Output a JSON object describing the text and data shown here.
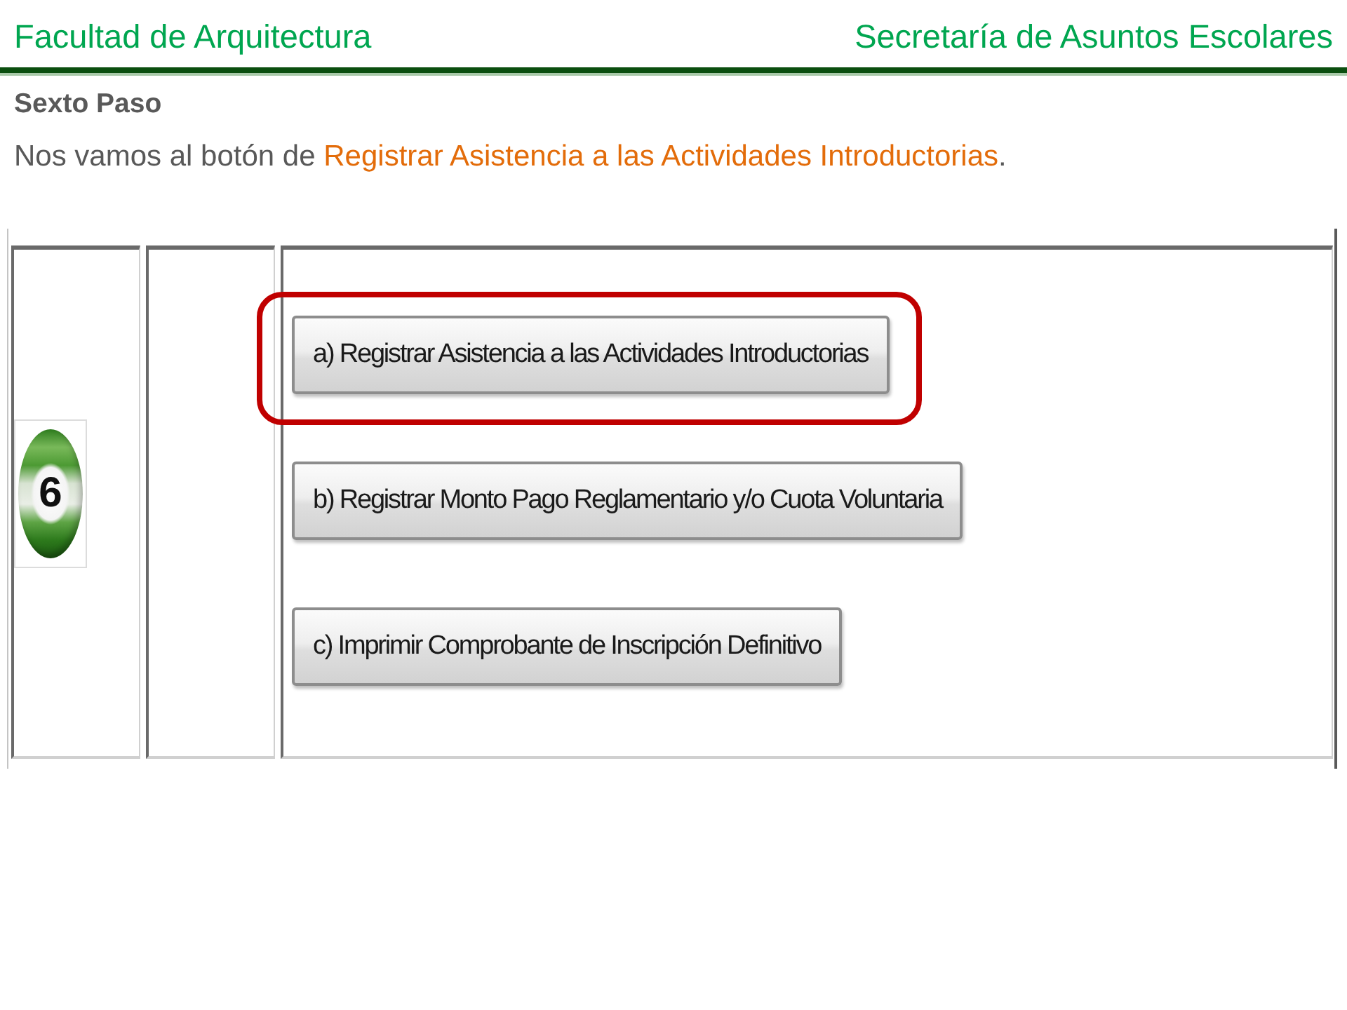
{
  "header": {
    "left_title": "Facultad de Arquitectura",
    "right_title": "Secretaría de Asuntos Escolares"
  },
  "step_title": "Sexto Paso",
  "instruction": [
    {
      "text": "Nos vamos al botón de ",
      "highlight": false
    },
    {
      "text": "Registrar Asistencia a las Actividades Introductorias",
      "highlight": true
    },
    {
      "text": ".",
      "highlight": false
    }
  ],
  "screenshot": {
    "step_number": "6",
    "buttons": [
      {
        "label": "a) Registrar Asistencia a las Actividades Introductorias",
        "highlighted": true
      },
      {
        "label": "b) Registrar Monto Pago Reglamentario y/o Cuota Voluntaria",
        "highlighted": false
      },
      {
        "label": "c) Imprimir Comprobante de Inscripción Definitivo",
        "highlighted": false
      }
    ]
  }
}
